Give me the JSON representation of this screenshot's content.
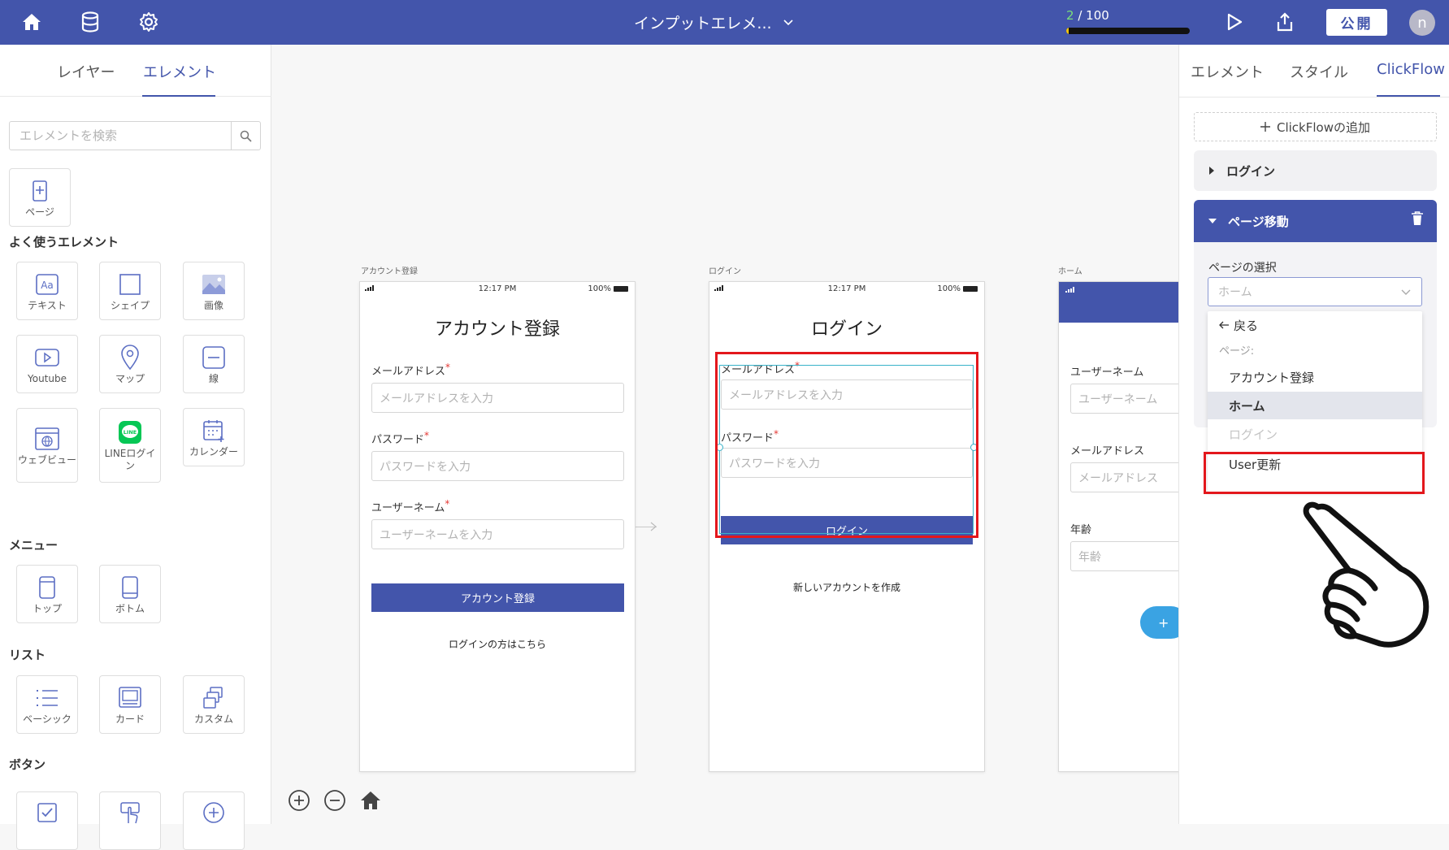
{
  "topbar": {
    "project_title": "インプットエレメ...",
    "progress_current": "2",
    "progress_total": "/ 100",
    "progress_fraction": 0.02,
    "publish_label": "公開",
    "avatar_initial": "n"
  },
  "left_panel": {
    "tabs": [
      "レイヤー",
      "エレメント"
    ],
    "active_tab": "エレメント",
    "search_placeholder": "エレメントを検索",
    "page_tile": "ページ",
    "sections": {
      "common": "よく使うエレメント",
      "menu": "メニュー",
      "list": "リスト",
      "button": "ボタン"
    },
    "common_elements": [
      "テキスト",
      "シェイプ",
      "画像",
      "Youtube",
      "マップ",
      "線",
      "ウェブビュー",
      "LINEログイン",
      "カレンダー"
    ],
    "menu_elements": [
      "トップ",
      "ボトム"
    ],
    "list_elements": [
      "ベーシック",
      "カード",
      "カスタム"
    ]
  },
  "canvas": {
    "screens": {
      "signup": {
        "label": "アカウント登録",
        "time": "12:17 PM",
        "battery": "100%",
        "title": "アカウント登録",
        "email_label": "メールアドレス",
        "email_placeholder": "メールアドレスを入力",
        "password_label": "パスワード",
        "password_placeholder": "パスワードを入力",
        "username_label": "ユーザーネーム",
        "username_placeholder": "ユーザーネームを入力",
        "button": "アカウント登録",
        "link": "ログインの方はこちら"
      },
      "login": {
        "label": "ログイン",
        "time": "12:17 PM",
        "battery": "100%",
        "title": "ログイン",
        "email_label": "メールアドレス",
        "email_placeholder": "メールアドレスを入力",
        "password_label": "パスワード",
        "password_placeholder": "パスワードを入力",
        "button": "ログイン",
        "link": "新しいアカウントを作成"
      },
      "home": {
        "label": "ホーム",
        "username_label": "ユーザーネーム",
        "username_placeholder": "ユーザーネーム",
        "email_label": "メールアドレス",
        "email_placeholder": "メールアドレス",
        "age_label": "年齢",
        "age_placeholder": "年齢",
        "fab": "+"
      }
    },
    "required_mark": "*"
  },
  "right_panel": {
    "tabs": [
      "エレメント",
      "スタイル",
      "ClickFlow"
    ],
    "active_tab": "ClickFlow",
    "add_flow": "ClickFlowの追加",
    "flows": [
      "ログイン",
      "ページ移動"
    ],
    "page_select_label": "ページの選択",
    "page_select_placeholder": "ホーム",
    "dropdown": {
      "back": "戻る",
      "group": "ページ:",
      "options": [
        "アカウント登録",
        "ホーム",
        "ログイン",
        "User更新"
      ],
      "selected": "ホーム",
      "disabled": "ログイン",
      "highlighted": "User更新"
    }
  },
  "colors": {
    "brand": "#4355ab",
    "highlight": "#e3171c",
    "selection": "#38b2c9",
    "fab": "#3aa3e3"
  }
}
